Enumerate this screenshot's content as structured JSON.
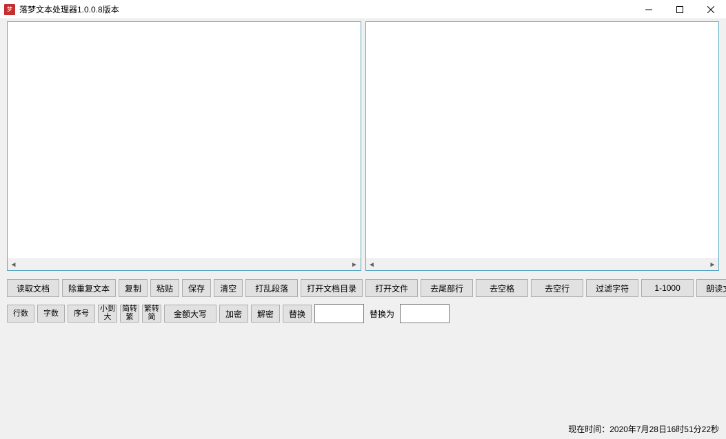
{
  "title": "落梦文本处理器1.0.0.8版本",
  "app_icon_text": "梦",
  "textareas": {
    "left_value": "",
    "right_value": ""
  },
  "toolbar1": {
    "read_doc": "读取文档",
    "remove_dup": "除重复文本",
    "copy": "复制",
    "paste": "粘贴",
    "save": "保存",
    "clear": "清空",
    "shuffle_para": "打乱段落",
    "open_doc_dir": "打开文档目录",
    "open_file": "打开文件",
    "trim_tail": "去尾部行",
    "trim_space": "去空格",
    "trim_empty_line": "去空行",
    "filter_char": "过滤字符",
    "range": "1-1000",
    "read_aloud": "朗读文本"
  },
  "toolbar2": {
    "line_count": "行数",
    "char_count": "字数",
    "index": "序号",
    "sort_asc": "小到大",
    "simp_to_trad": "简转繁",
    "trad_to_simp": "繁转简",
    "amount_upper": "金额大写",
    "encrypt": "加密",
    "decrypt": "解密",
    "replace": "替换",
    "replace_from_value": "",
    "replace_label": "替换为",
    "replace_to_value": ""
  },
  "status": {
    "time_label": "现在时间：2020年7月28日16时51分22秒"
  }
}
